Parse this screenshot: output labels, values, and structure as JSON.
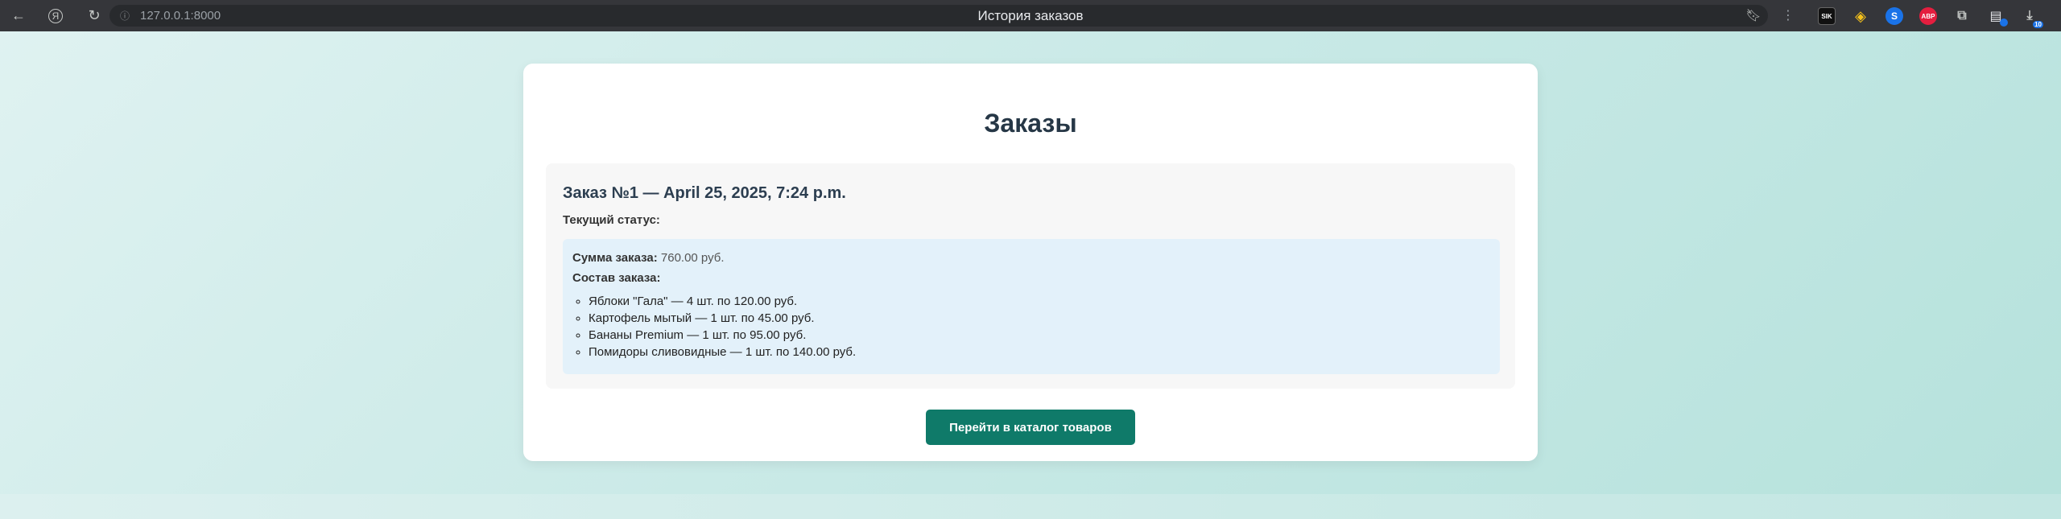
{
  "browser": {
    "tab_title": "История заказов",
    "url": "127.0.0.1:8000",
    "extensions": {
      "sik": "SIK",
      "abp": "ABP",
      "download_count": "10"
    }
  },
  "page": {
    "heading": "Заказы",
    "order": {
      "title": "Заказ №1 — April 25, 2025, 7:24 p.m.",
      "status_label": "Текущий статус:",
      "status_value": "",
      "sum_label": "Сумма заказа:",
      "sum_value": "760.00 руб.",
      "composition_label": "Состав заказа:",
      "items": [
        "Яблоки \"Гала\" — 4 шт. по 120.00 руб.",
        "Картофель мытый — 1 шт. по 45.00 руб.",
        "Бананы Premium — 1 шт. по 95.00 руб.",
        "Помидоры сливовидные — 1 шт. по 140.00 руб."
      ]
    },
    "catalog_button": "Перейти в каталог товаров"
  },
  "colors": {
    "button": "#0f7a69",
    "details_bg": "#e3f1fa",
    "heading": "#263746"
  }
}
